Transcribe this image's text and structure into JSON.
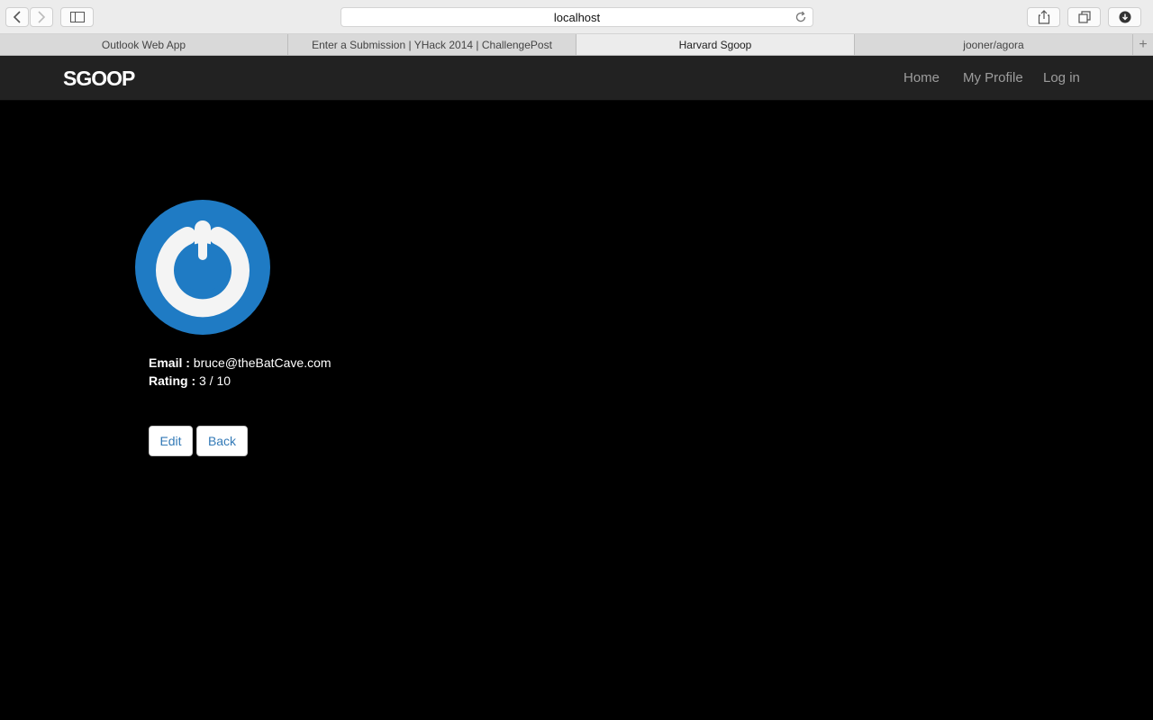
{
  "browser": {
    "url": "localhost",
    "tabs": [
      {
        "label": "Outlook Web App"
      },
      {
        "label": "Enter a Submission | YHack 2014 | ChallengePost"
      },
      {
        "label": "Harvard Sgoop"
      },
      {
        "label": "jooner/agora"
      }
    ],
    "new_tab": "+"
  },
  "navbar": {
    "brand": "SGOOP",
    "links": [
      "Home",
      "My Profile",
      "Log in"
    ]
  },
  "profile": {
    "email_label": "Email :",
    "email_value": "bruce@theBatCave.com",
    "rating_label": "Rating :",
    "rating_value": "3 / 10",
    "avatar_icon": "power-icon",
    "avatar_color": "#1f7bc4"
  },
  "buttons": {
    "edit": "Edit",
    "back": "Back"
  }
}
